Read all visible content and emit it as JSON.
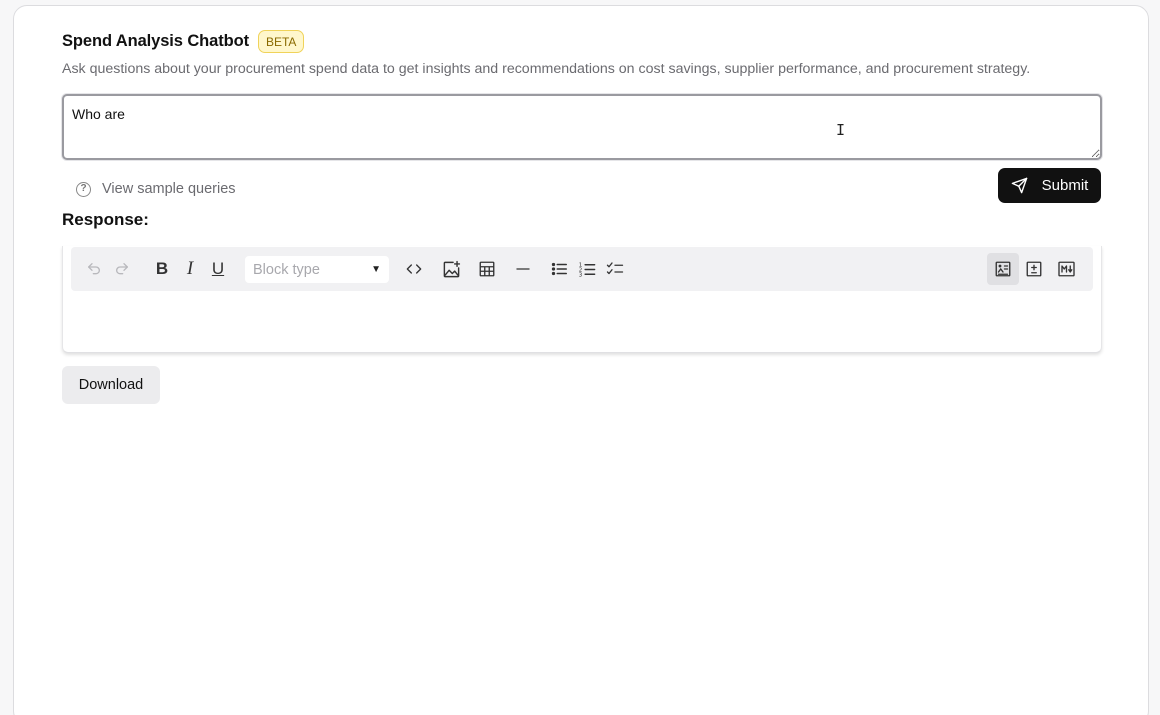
{
  "header": {
    "title": "Spend Analysis Chatbot",
    "badge": "BETA",
    "subtitle": "Ask questions about your procurement spend data to get insights and recommendations on cost savings, supplier performance, and procurement strategy."
  },
  "query": {
    "value": "Who are "
  },
  "sample_queries": {
    "label": "View sample queries",
    "icon": "question-circle-icon"
  },
  "submit": {
    "label": "Submit",
    "icon": "send-icon"
  },
  "response": {
    "label": "Response:",
    "toolbar": {
      "block_type_placeholder": "Block type",
      "buttons": [
        "undo-icon",
        "redo-icon",
        "bold-icon",
        "italic-icon",
        "underline-icon",
        "code-icon",
        "insert-image-icon",
        "table-icon",
        "horizontal-rule-icon",
        "bullet-list-icon",
        "numbered-list-icon",
        "checklist-icon",
        "rich-text-mode-icon",
        "diff-mode-icon",
        "markdown-mode-icon"
      ]
    },
    "content": ""
  },
  "download": {
    "label": "Download"
  }
}
